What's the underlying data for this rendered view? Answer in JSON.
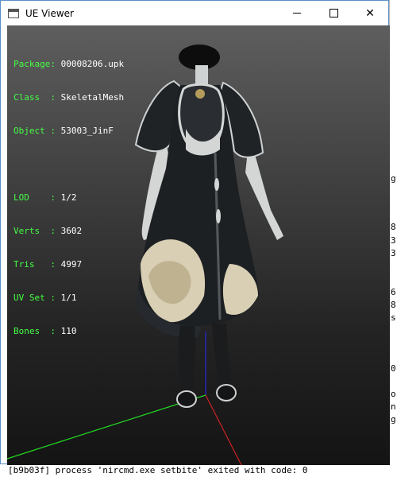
{
  "window": {
    "title": "UE Viewer"
  },
  "stats": [
    {
      "label": "Package",
      "value": "00008206.upk"
    },
    {
      "label": "Class  ",
      "value": "SkeletalMesh"
    },
    {
      "label": "Object ",
      "value": "53003_JinF"
    },
    {
      "label": "",
      "value": ""
    },
    {
      "label": "LOD    ",
      "value": "1/2"
    },
    {
      "label": "Verts  ",
      "value": "3602"
    },
    {
      "label": "Tris   ",
      "value": "4997"
    },
    {
      "label": "UV Set ",
      "value": "1/1"
    },
    {
      "label": "Bones  ",
      "value": "110"
    }
  ],
  "background_console": {
    "bottom_line": "[b9b03f] process 'nircmd.exe setbite' exited with code: 0",
    "right_chars": [
      "g",
      "8",
      "3",
      "3",
      "6",
      "8",
      "s",
      "0",
      "o",
      "n",
      "g"
    ]
  },
  "colors": {
    "stat_label": "#44ff44",
    "stat_value": "#ffffff",
    "axis_x": "#cc2222",
    "axis_y": "#22cc22",
    "axis_z": "#2222cc",
    "dress": "#1c1f22",
    "skin": "#d8dada",
    "trim": "#d9cfb4"
  },
  "icons": {
    "app": "window-icon",
    "minimize": "minimize-icon",
    "maximize": "maximize-icon",
    "close": "close-icon"
  }
}
